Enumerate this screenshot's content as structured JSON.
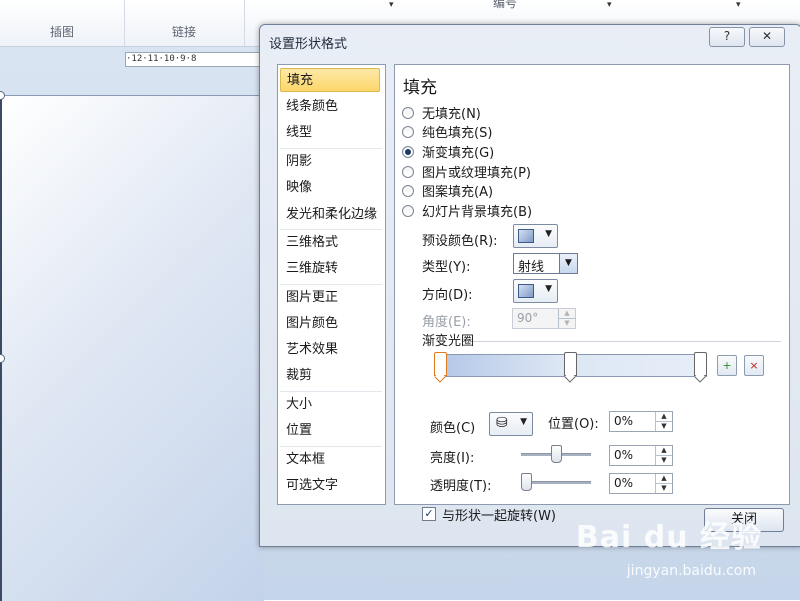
{
  "ribbon": {
    "group1_label": "插图",
    "group2_label": "链接",
    "top_label": "编号",
    "arrow": "▾"
  },
  "ruler": {
    "text": "·12·11·10·9·8"
  },
  "dialog": {
    "title": "设置形状格式",
    "help_label": "?",
    "close_x_label": "✕",
    "nav": [
      "填充",
      "线条颜色",
      "线型",
      "阴影",
      "映像",
      "发光和柔化边缘",
      "三维格式",
      "三维旋转",
      "图片更正",
      "图片颜色",
      "艺术效果",
      "裁剪",
      "大小",
      "位置",
      "文本框",
      "可选文字"
    ],
    "selected_nav": "填充",
    "content": {
      "heading": "填充",
      "fill_options": [
        {
          "label": "无填充(N)",
          "checked": false
        },
        {
          "label": "纯色填充(S)",
          "checked": false
        },
        {
          "label": "渐变填充(G)",
          "checked": true
        },
        {
          "label": "图片或纹理填充(P)",
          "checked": false
        },
        {
          "label": "图案填充(A)",
          "checked": false
        },
        {
          "label": "幻灯片背景填充(B)",
          "checked": false
        }
      ],
      "preset_label": "预设颜色(R):",
      "type_label": "类型(Y):",
      "type_value": "射线",
      "direction_label": "方向(D):",
      "angle_label": "角度(E):",
      "angle_value": "90°",
      "gradient_stops_label": "渐变光圈",
      "stops_percent": [
        0,
        50,
        100
      ],
      "color_label": "颜色(C)",
      "position_label": "位置(O):",
      "position_value": "0%",
      "brightness_label": "亮度(I):",
      "brightness_value": "0%",
      "transparency_label": "透明度(T):",
      "transparency_value": "0%",
      "rotate_label": "与形状一起旋转(W)",
      "rotate_checked": true,
      "spin_up": "▲",
      "spin_down": "▼",
      "dropdown_arrow": "▼",
      "add_stop_icon": "add-gradient-stop-icon",
      "remove_stop_icon": "remove-gradient-stop-icon"
    },
    "close_button_label": "关闭"
  },
  "watermark": {
    "main": "Bai du 经验",
    "sub": "jingyan.baidu.com"
  },
  "colors": {
    "selected_nav_bg": "#fbd66b",
    "dialog_bg": "#e3e9f2",
    "active_stop": "#e07a1c"
  }
}
